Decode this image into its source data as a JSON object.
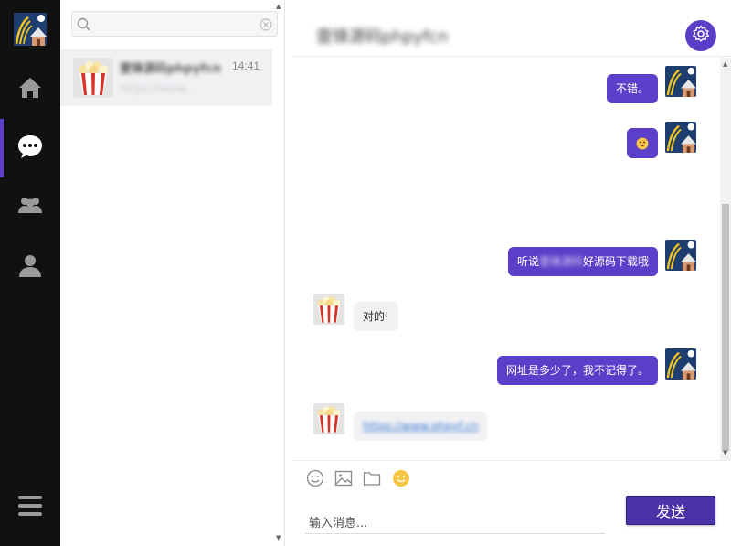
{
  "colors": {
    "accent": "#5b3fc9",
    "sidebar_bg": "#111111",
    "send_button": "#4a32a8"
  },
  "search": {
    "placeholder": ""
  },
  "conversations": [
    {
      "name": "壹锋源码phpyfcn",
      "time": "14:41",
      "preview": "https://www..."
    }
  ],
  "chat": {
    "title": "壹锋源码phpyfcn",
    "messages": [
      {
        "side": "out",
        "text": "不错。"
      },
      {
        "side": "out",
        "text": "emoji"
      },
      {
        "side": "out",
        "text_prefix": "听说",
        "text_blurred": "壹锋源码",
        "text_suffix": "好源码下载哦"
      },
      {
        "side": "in",
        "text": "对的!"
      },
      {
        "side": "out",
        "text": "网址是多少了，我不记得了。"
      },
      {
        "side": "in",
        "text": "https://www.phpyf.cn"
      }
    ]
  },
  "composer": {
    "placeholder": "输入消息...",
    "send_label": "发送"
  },
  "icons": {
    "sidebar": [
      "home-icon",
      "chat-icon",
      "group-icon",
      "user-icon",
      "menu-icon"
    ],
    "toolbar": [
      "emoji-icon",
      "image-icon",
      "folder-icon",
      "sticker-icon"
    ],
    "header": [
      "gear-icon"
    ]
  }
}
